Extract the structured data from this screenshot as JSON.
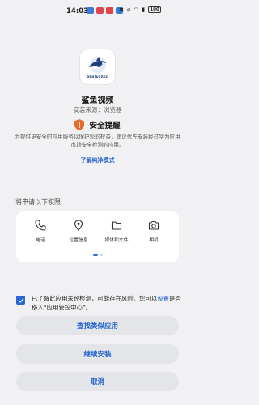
{
  "status_bar": {
    "time": "14:03",
    "battery": "100",
    "icons": [
      "sim-app-icon",
      "app-icon",
      "app-icon",
      "app-icon",
      "bluetooth-icon",
      "mute-icon",
      "wifi-icon",
      "signal-icon"
    ],
    "app_colors": [
      "#3a7bd5",
      "#e0454e",
      "#e0454e",
      "#3a7bd5"
    ]
  },
  "app": {
    "name": "鲨鱼视频",
    "source": "安装来源：浏览器",
    "icon_brand": "ShaYuTV.cc"
  },
  "security": {
    "title": "安全提醒",
    "description": "为提供更安全的应用服务以保护您的权益，建议优先安装经过华为应用市场安全检测的应用。",
    "link": "了解纯净模式",
    "shield_color": "#e86a2a"
  },
  "permissions": {
    "title": "将申请以下权限",
    "items": [
      {
        "label": "电话",
        "icon": "phone-icon"
      },
      {
        "label": "位置信息",
        "icon": "location-icon"
      },
      {
        "label": "媒体和文件",
        "icon": "folder-icon"
      },
      {
        "label": "相机",
        "icon": "camera-icon"
      }
    ],
    "page_count": 2,
    "current_page": 1
  },
  "consent": {
    "checked": true,
    "text_before": "已了解此应用未经检测，可能存在风险。您可以",
    "link": "设置",
    "text_after": "是否移入“应用管控中心”。"
  },
  "buttons": {
    "find_similar": "查找类似应用",
    "continue_install": "继续安装",
    "cancel": "取消"
  },
  "colors": {
    "accent": "#1f5fcc",
    "background": "#f1f1f3",
    "button_bg": "#e4e5e9"
  }
}
